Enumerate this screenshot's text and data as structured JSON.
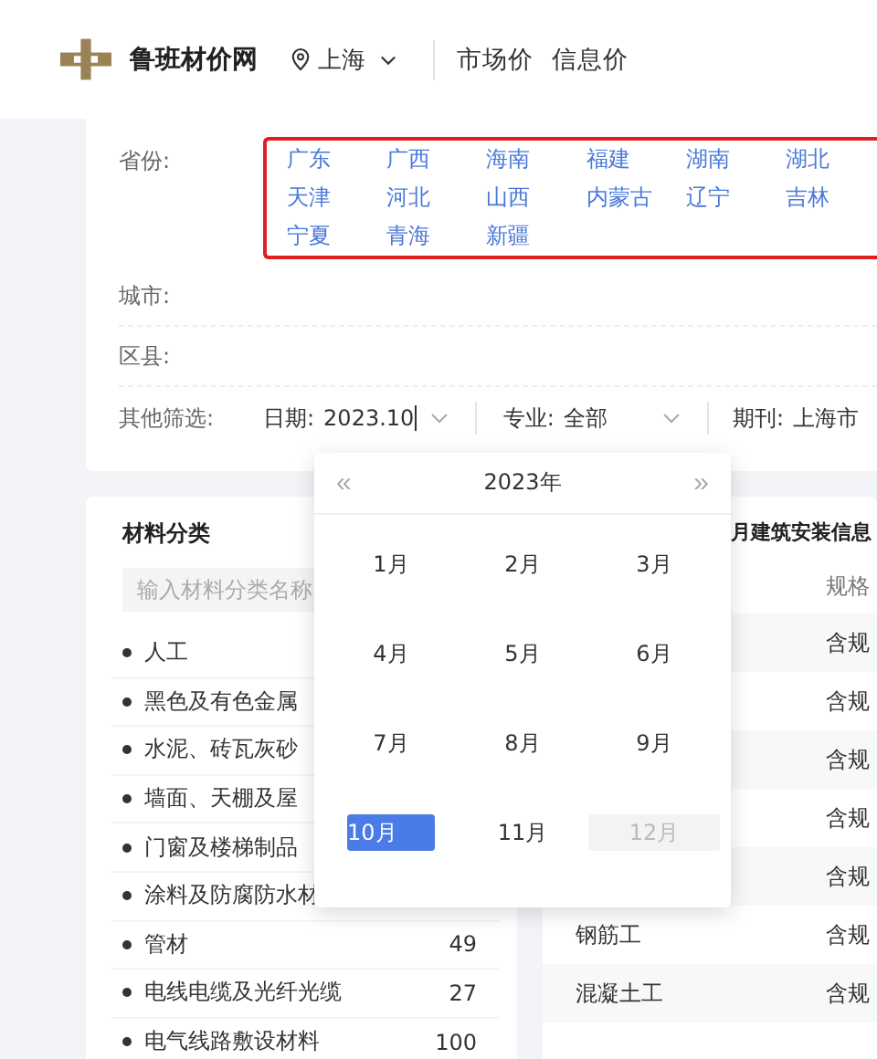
{
  "header": {
    "site_name": "鲁班材价网",
    "location": "上海",
    "nav": [
      "市场价",
      "信息价"
    ]
  },
  "filters": {
    "province_label": "省份:",
    "provinces": [
      "广东",
      "广西",
      "海南",
      "福建",
      "湖南",
      "湖北",
      "天津",
      "河北",
      "山西",
      "内蒙古",
      "辽宁",
      "吉林",
      "宁夏",
      "青海",
      "新疆"
    ],
    "city_label": "城市:",
    "district_label": "区县:",
    "other_label": "其他筛选:",
    "selects": [
      {
        "label": "日期:",
        "value": "2023.10"
      },
      {
        "label": "专业:",
        "value": "全部"
      },
      {
        "label": "期刊:",
        "value": "上海市"
      }
    ]
  },
  "date_picker": {
    "prev": "«",
    "year": "2023年",
    "next": "»",
    "months": [
      {
        "label": "1月",
        "selected": false,
        "disabled": false
      },
      {
        "label": "2月",
        "selected": false,
        "disabled": false
      },
      {
        "label": "3月",
        "selected": false,
        "disabled": false
      },
      {
        "label": "4月",
        "selected": false,
        "disabled": false
      },
      {
        "label": "5月",
        "selected": false,
        "disabled": false
      },
      {
        "label": "6月",
        "selected": false,
        "disabled": false
      },
      {
        "label": "7月",
        "selected": false,
        "disabled": false
      },
      {
        "label": "8月",
        "selected": false,
        "disabled": false
      },
      {
        "label": "9月",
        "selected": false,
        "disabled": false
      },
      {
        "label": "10月",
        "selected": true,
        "disabled": false
      },
      {
        "label": "11月",
        "selected": false,
        "disabled": false
      },
      {
        "label": "12月",
        "selected": false,
        "disabled": true
      }
    ]
  },
  "category_panel": {
    "title": "材料分类",
    "search_placeholder": "输入材料分类名称",
    "items": [
      {
        "name": "人工"
      },
      {
        "name": "黑色及有色金属"
      },
      {
        "name": "水泥、砖瓦灰砂"
      },
      {
        "name": "墙面、天棚及屋"
      },
      {
        "name": "门窗及楼梯制品"
      },
      {
        "name": "涂料及防腐防水材"
      },
      {
        "name": "管材",
        "count": "49"
      },
      {
        "name": "电线电缆及光纤光缆",
        "count": "27"
      },
      {
        "name": "电气线路敷设材料",
        "count": "100"
      }
    ]
  },
  "info_panel": {
    "title": "月建筑安装信息",
    "column_2": "规格",
    "rows": [
      {
        "column_2": "含规"
      },
      {
        "column_2": "含规"
      },
      {
        "column_2": "含规"
      },
      {
        "column_2": "含规"
      },
      {
        "column_2": "含规"
      },
      {
        "column_1": "钢筋工",
        "column_2": "含规"
      },
      {
        "column_1": "混凝土工",
        "column_2": "含规"
      }
    ]
  }
}
